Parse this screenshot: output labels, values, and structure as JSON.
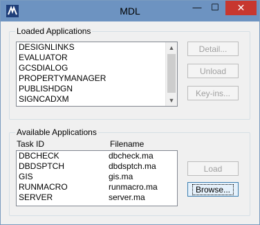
{
  "window": {
    "title": "MDL"
  },
  "titlebar": {
    "minimize_glyph": "—",
    "maximize_glyph": "☐",
    "close_glyph": "✕",
    "app_icon": "mdl-app-icon"
  },
  "loaded": {
    "group_label": "Loaded Applications",
    "items": [
      "DESIGNLINKS",
      "EVALUATOR",
      "GCSDIALOG",
      "PROPERTYMANAGER",
      "PUBLISHDGN",
      "SIGNCADXM"
    ],
    "buttons": {
      "detail": "Detail...",
      "unload": "Unload",
      "keyins": "Key-ins..."
    }
  },
  "available": {
    "group_label": "Available Applications",
    "columns": {
      "task_id": "Task ID",
      "filename": "Filename"
    },
    "rows": [
      {
        "task_id": "DBCHECK",
        "filename": "dbcheck.ma"
      },
      {
        "task_id": "DBDSPTCH",
        "filename": "dbdsptch.ma"
      },
      {
        "task_id": "GIS",
        "filename": "gis.ma"
      },
      {
        "task_id": "RUNMACRO",
        "filename": "runmacro.ma"
      },
      {
        "task_id": "SERVER",
        "filename": "server.ma"
      }
    ],
    "buttons": {
      "load": "Load",
      "browse": "Browse..."
    }
  }
}
